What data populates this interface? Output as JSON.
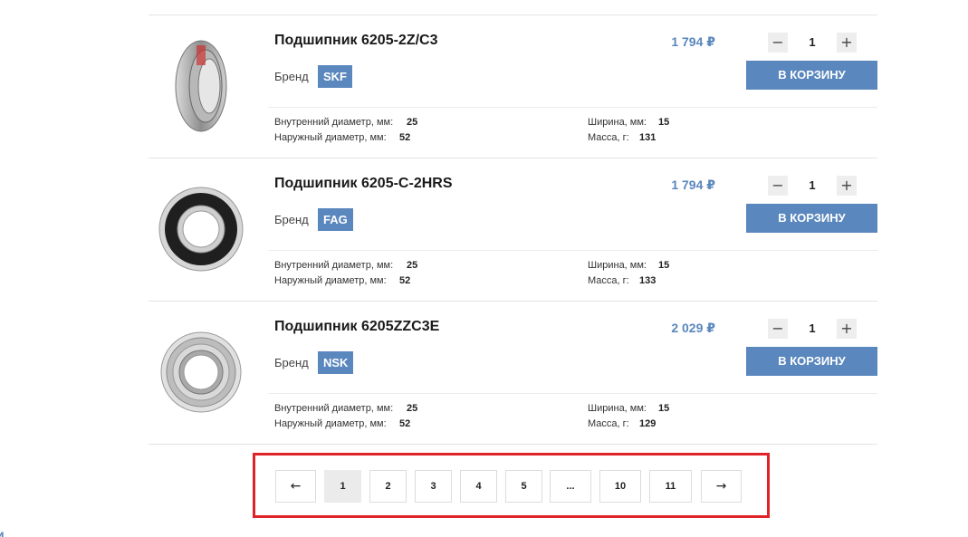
{
  "top_cut_text": "...",
  "products": [
    {
      "title": "Подшипник 6205-2Z/C3",
      "brand_label": "Бренд",
      "brand": "SKF",
      "price": "1 794 ₽",
      "qty": "1",
      "cart_label": "В КОРЗИНУ",
      "specs": {
        "inner_label": "Внутренний диаметр, мм:",
        "inner": "25",
        "outer_label": "Наружный диаметр, мм:",
        "outer": "52",
        "width_label": "Ширина, мм:",
        "width": "15",
        "mass_label": "Масса, г:",
        "mass": "131"
      }
    },
    {
      "title": "Подшипник 6205-C-2HRS",
      "brand_label": "Бренд",
      "brand": "FAG",
      "price": "1 794 ₽",
      "qty": "1",
      "cart_label": "В КОРЗИНУ",
      "specs": {
        "inner_label": "Внутренний диаметр, мм:",
        "inner": "25",
        "outer_label": "Наружный диаметр, мм:",
        "outer": "52",
        "width_label": "Ширина, мм:",
        "width": "15",
        "mass_label": "Масса, г:",
        "mass": "133"
      }
    },
    {
      "title": "Подшипник 6205ZZC3E",
      "brand_label": "Бренд",
      "brand": "NSK",
      "price": "2 029 ₽",
      "qty": "1",
      "cart_label": "В КОРЗИНУ",
      "specs": {
        "inner_label": "Внутренний диаметр, мм:",
        "inner": "25",
        "outer_label": "Наружный диаметр, мм:",
        "outer": "52",
        "width_label": "Ширина, мм:",
        "width": "15",
        "mass_label": "Масса, г:",
        "mass": "129"
      }
    }
  ],
  "qty_minus": "−",
  "qty_plus": "+",
  "pagination": {
    "prev": "←",
    "pages": [
      "1",
      "2",
      "3",
      "4",
      "5",
      "...",
      "10",
      "11"
    ],
    "current": "1",
    "next": "→"
  },
  "bottom_left_text": "и",
  "colors": {
    "accent": "#5a87bd",
    "highlight_frame": "#e02229"
  }
}
